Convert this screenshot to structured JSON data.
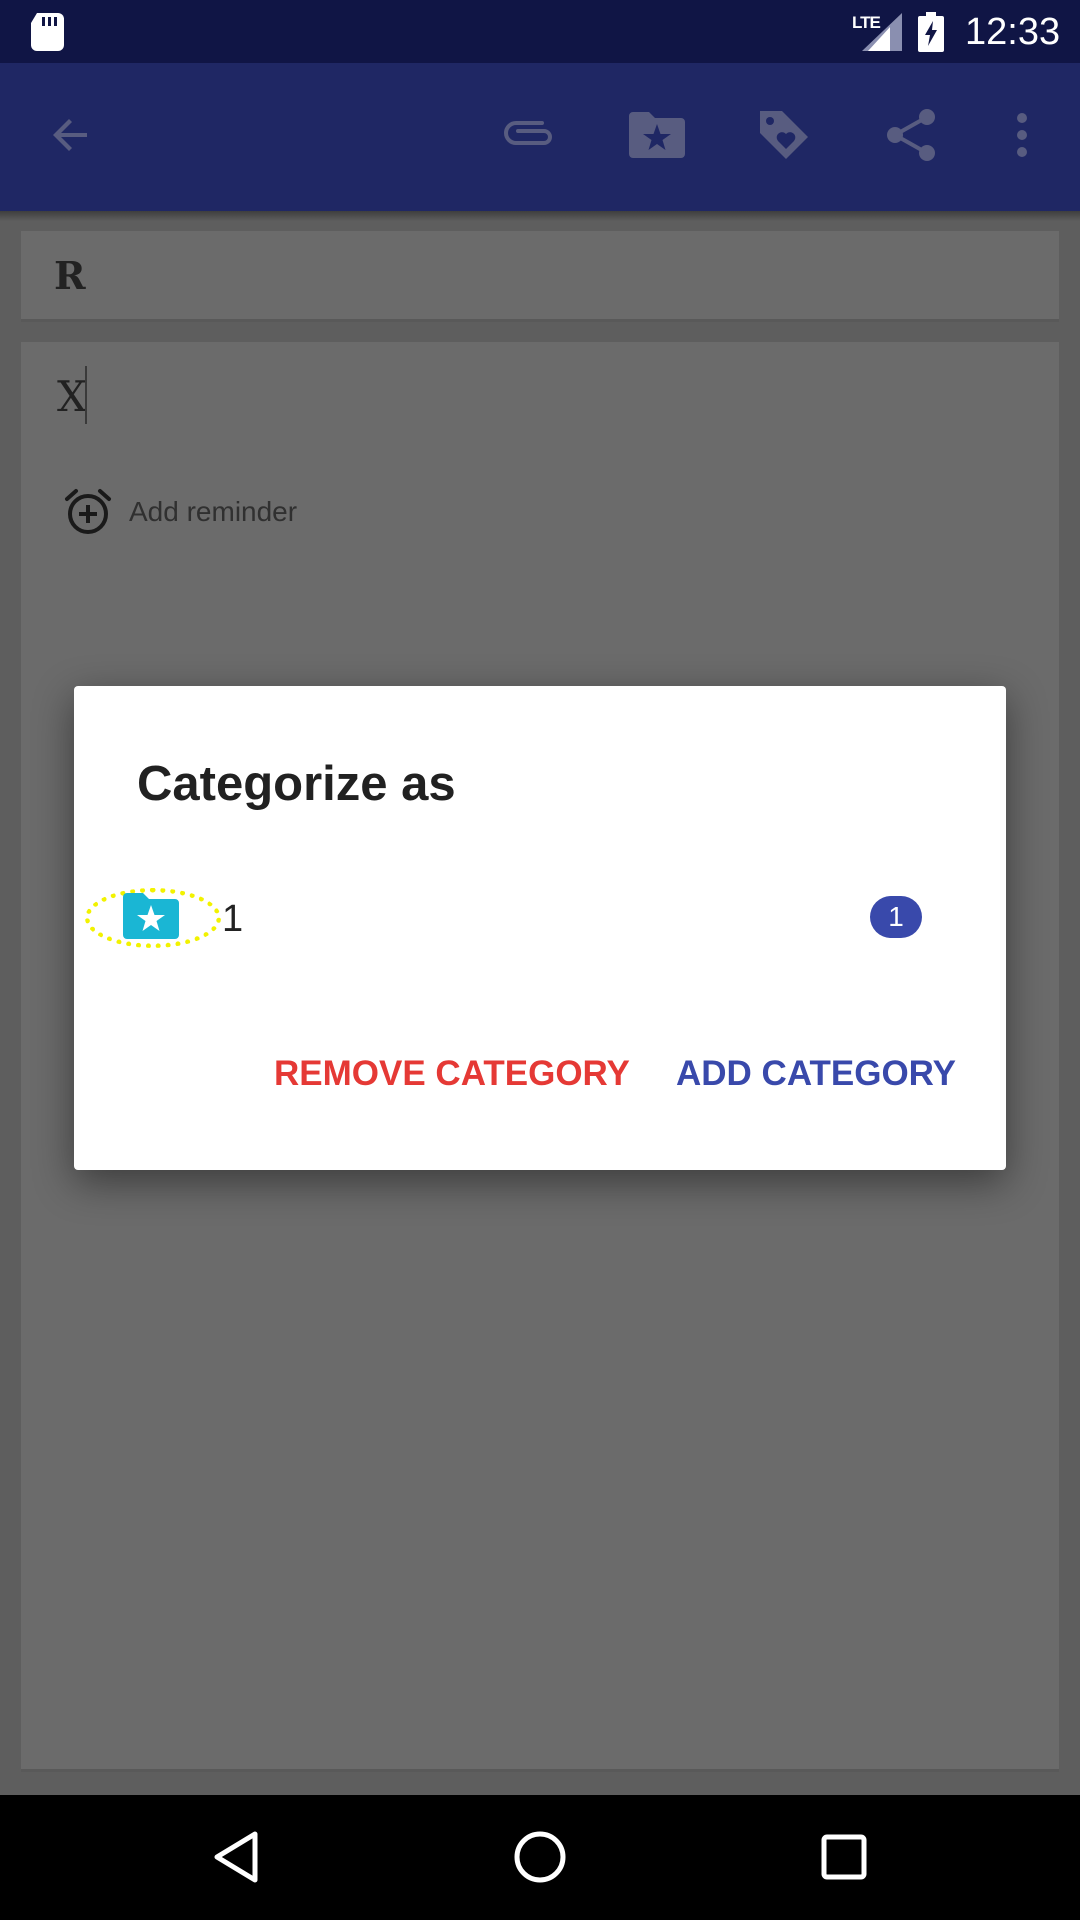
{
  "status_bar": {
    "network": "LTE",
    "time": "12:33",
    "icons": [
      "sd-card-icon",
      "signal-icon",
      "battery-charging-icon"
    ]
  },
  "toolbar": {
    "icons": [
      "back-arrow-icon",
      "attachment-icon",
      "category-folder-icon",
      "tag-icon",
      "share-icon",
      "more-options-icon"
    ]
  },
  "note": {
    "title": "R",
    "content": "X",
    "reminder_label": "Add reminder"
  },
  "dialog": {
    "title": "Categorize as",
    "categories": [
      {
        "name": "1",
        "count": "1",
        "color": "#1ab6d4"
      }
    ],
    "remove_label": "REMOVE CATEGORY",
    "add_label": "ADD CATEGORY"
  },
  "nav_bar": {
    "icons": [
      "back-triangle-icon",
      "home-circle-icon",
      "recents-square-icon"
    ]
  },
  "colors": {
    "primary_dark": "#101545",
    "primary": "#1f2764",
    "accent_blue": "#3949ab",
    "danger_red": "#e53935",
    "highlight_yellow": "#f2f200"
  }
}
